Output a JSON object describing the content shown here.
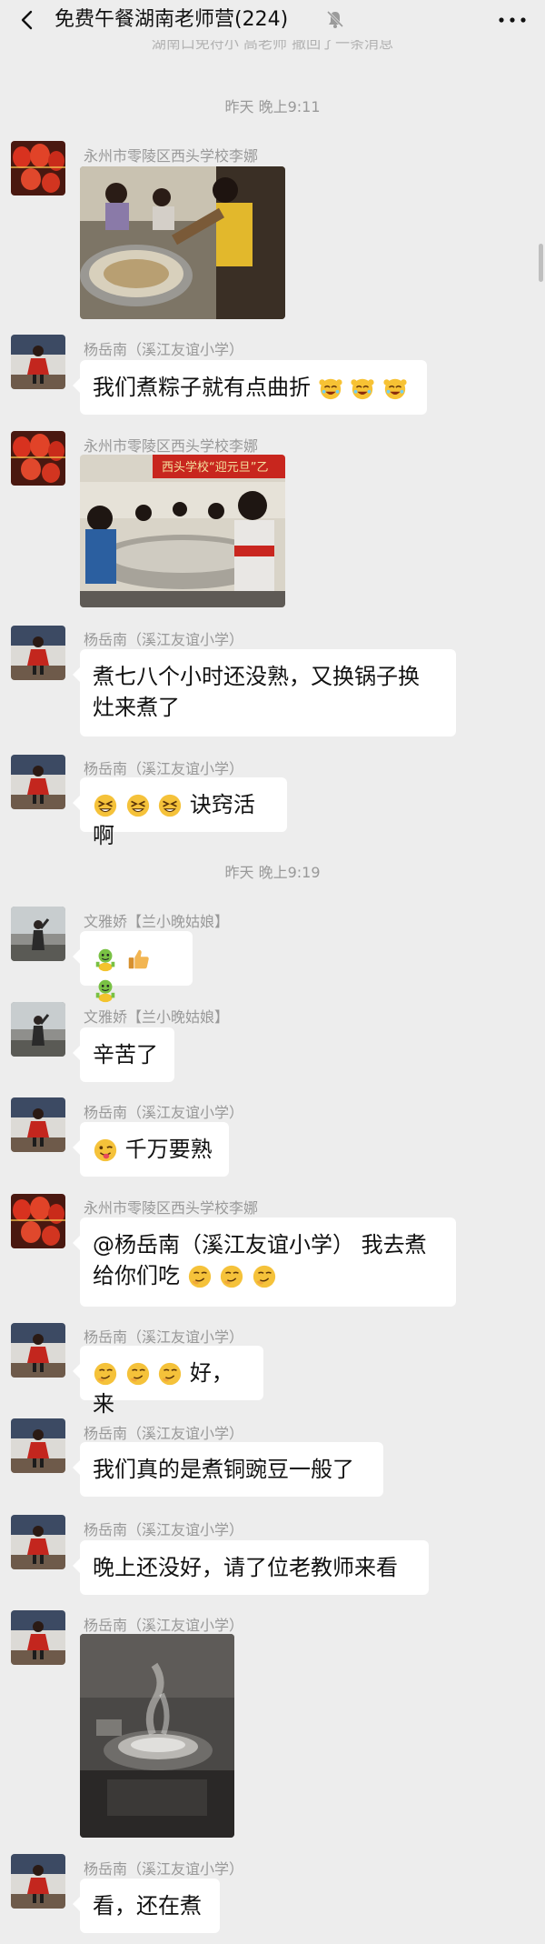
{
  "header": {
    "title": "免费午餐湖南老师营(224)",
    "back_icon": "chevron-left-icon",
    "mute_icon": "bell-muted-icon",
    "more_icon": "more-dots-icon"
  },
  "partial_banner": "湖南口免符小 高老师 撤回了一条消息",
  "timestamps": [
    "昨天 晚上9:11",
    "昨天 晚上9:19"
  ],
  "messages": [
    {
      "sender": "永州市零陵区西头学校李娜",
      "type": "image"
    },
    {
      "sender": "杨岳南（溪江友谊小学）",
      "text": "我们煮粽子就有点曲折"
    },
    {
      "sender": "永州市零陵区西头学校李娜",
      "type": "image",
      "banner_text": "西头学校“迎元旦”乙"
    },
    {
      "sender": "杨岳南（溪江友谊小学）",
      "text_line1": "煮七八个小时还没熟，又换锅子换",
      "text_line2": "灶来煮了"
    },
    {
      "sender": "杨岳南（溪江友谊小学）",
      "text": "诀窍活啊"
    },
    {
      "sender": "文雅娇【兰小晚姑娘】",
      "text": ""
    },
    {
      "sender": "文雅娇【兰小晚姑娘】",
      "text": "辛苦了"
    },
    {
      "sender": "杨岳南（溪江友谊小学）",
      "text": "千万要熟"
    },
    {
      "sender": "永州市零陵区西头学校李娜",
      "text_line1": "@杨岳南（溪江友谊小学） 我去煮",
      "text_line2": "给你们吃"
    },
    {
      "sender": "杨岳南（溪江友谊小学）",
      "text": "好，来"
    },
    {
      "sender": "杨岳南（溪江友谊小学）",
      "text": "我们真的是煮铜豌豆一般了"
    },
    {
      "sender": "杨岳南（溪江友谊小学）",
      "text": "晚上还没好，请了位老教师来看"
    },
    {
      "sender": "杨岳南（溪江友谊小学）",
      "type": "image"
    },
    {
      "sender": "杨岳南（溪江友谊小学）",
      "text": "看，还在煮"
    }
  ],
  "colors": {
    "background": "#ededed",
    "bubble": "#ffffff",
    "meta_text": "#999999"
  }
}
